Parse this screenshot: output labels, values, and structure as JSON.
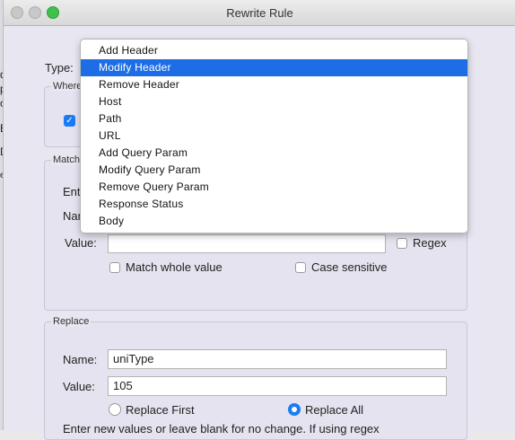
{
  "window": {
    "title": "Rewrite Rule"
  },
  "background_fragments": [
    "d",
    "p",
    "o",
    "E",
    "D",
    "et"
  ],
  "type_row": {
    "label": "Type:"
  },
  "where_panel": {
    "title": "Where"
  },
  "match_panel": {
    "title": "Match",
    "enter_label": "Ent",
    "name_label": "Nan",
    "value_label": "Value:",
    "value_field": "",
    "regex_label": "Regex",
    "match_whole_label": "Match whole value",
    "case_sensitive_label": "Case sensitive"
  },
  "replace_panel": {
    "title": "Replace",
    "name_label": "Name:",
    "name_value": "uniType",
    "value_label": "Value:",
    "value_value": "105",
    "replace_first_label": "Replace First",
    "replace_all_label": "Replace All",
    "hint": "Enter new values or leave blank for no change. If using regex"
  },
  "dropdown": {
    "selected": "Modify Header",
    "options": [
      "Add Header",
      "Modify Header",
      "Remove Header",
      "Host",
      "Path",
      "URL",
      "Add Query Param",
      "Modify Query Param",
      "Remove Query Param",
      "Response Status",
      "Body"
    ]
  },
  "colors": {
    "accent": "#1a7cf5",
    "selection": "#1d6ee6",
    "traffic_max": "#3fc14b"
  }
}
